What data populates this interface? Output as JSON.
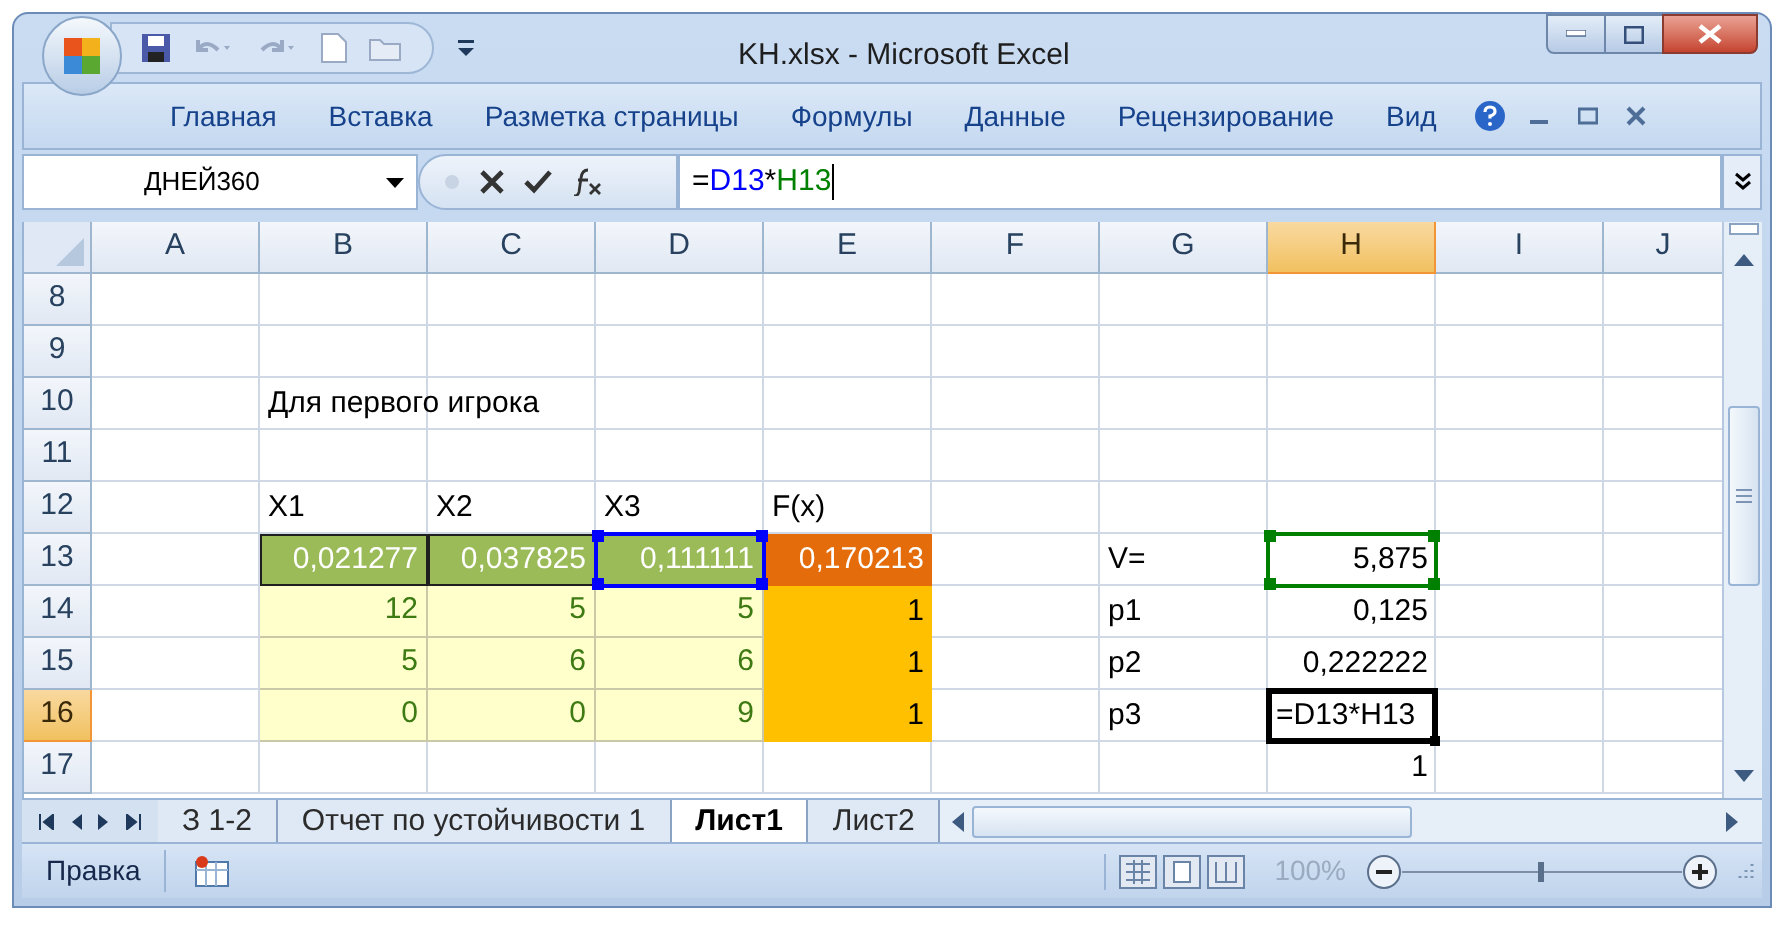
{
  "window": {
    "title": "KH.xlsx - Microsoft Excel"
  },
  "ribbon_tabs": [
    "Главная",
    "Вставка",
    "Разметка страницы",
    "Формулы",
    "Данные",
    "Рецензирование",
    "Вид"
  ],
  "formula_bar": {
    "name_box": "ДНЕЙ360",
    "formula": [
      {
        "text": "=",
        "color": "#000000"
      },
      {
        "text": "D13",
        "color": "#0000ff"
      },
      {
        "text": "*",
        "color": "#000000"
      },
      {
        "text": "H13",
        "color": "#008000"
      }
    ]
  },
  "columns": [
    {
      "label": "A",
      "selected": false
    },
    {
      "label": "B",
      "selected": false
    },
    {
      "label": "C",
      "selected": false
    },
    {
      "label": "D",
      "selected": false
    },
    {
      "label": "E",
      "selected": false
    },
    {
      "label": "F",
      "selected": false
    },
    {
      "label": "G",
      "selected": false
    },
    {
      "label": "H",
      "selected": true
    },
    {
      "label": "I",
      "selected": false
    },
    {
      "label": "J",
      "selected": false
    }
  ],
  "rows": [
    {
      "label": "8",
      "selected": false,
      "cells": [
        null,
        null,
        null,
        null,
        null,
        null,
        null,
        null,
        null,
        null
      ]
    },
    {
      "label": "9",
      "selected": false,
      "cells": [
        null,
        null,
        null,
        null,
        null,
        null,
        null,
        null,
        null,
        null
      ]
    },
    {
      "label": "10",
      "selected": false,
      "cells": [
        null,
        {
          "text": "Для первого игрока",
          "kind": "text"
        },
        null,
        null,
        null,
        null,
        null,
        null,
        null,
        null
      ]
    },
    {
      "label": "11",
      "selected": false,
      "cells": [
        null,
        null,
        null,
        null,
        null,
        null,
        null,
        null,
        null,
        null
      ]
    },
    {
      "label": "12",
      "selected": false,
      "cells": [
        null,
        {
          "text": "X1",
          "kind": "text"
        },
        {
          "text": "X2",
          "kind": "text"
        },
        {
          "text": "X3",
          "kind": "text"
        },
        {
          "text": "F(x)",
          "kind": "text"
        },
        null,
        null,
        null,
        null,
        null
      ]
    },
    {
      "label": "13",
      "selected": false,
      "cells": [
        null,
        {
          "text": "0,021277",
          "kind": "result"
        },
        {
          "text": "0,037825",
          "kind": "result"
        },
        {
          "text": "0,111111",
          "kind": "result",
          "reference": {
            "color": "#0000ff"
          }
        },
        {
          "text": "0,170213",
          "kind": "objective"
        },
        null,
        {
          "text": "V=",
          "kind": "text"
        },
        {
          "text": "5,875",
          "kind": "number",
          "reference": {
            "color": "#008000"
          }
        },
        null,
        null
      ]
    },
    {
      "label": "14",
      "selected": false,
      "cells": [
        null,
        {
          "text": "12",
          "kind": "input"
        },
        {
          "text": "5",
          "kind": "input"
        },
        {
          "text": "5",
          "kind": "input"
        },
        {
          "text": "1",
          "kind": "constraint"
        },
        null,
        {
          "text": "p1",
          "kind": "text"
        },
        {
          "text": "0,125",
          "kind": "number"
        },
        null,
        null
      ]
    },
    {
      "label": "15",
      "selected": false,
      "cells": [
        null,
        {
          "text": "5",
          "kind": "input"
        },
        {
          "text": "6",
          "kind": "input"
        },
        {
          "text": "6",
          "kind": "input"
        },
        {
          "text": "1",
          "kind": "constraint"
        },
        null,
        {
          "text": "p2",
          "kind": "text"
        },
        {
          "text": "0,222222",
          "kind": "number"
        },
        null,
        null
      ]
    },
    {
      "label": "16",
      "selected": true,
      "cells": [
        null,
        {
          "text": "0",
          "kind": "input"
        },
        {
          "text": "0",
          "kind": "input"
        },
        {
          "text": "9",
          "kind": "input"
        },
        {
          "text": "1",
          "kind": "constraint"
        },
        null,
        {
          "text": "p3",
          "kind": "text"
        },
        {
          "text": "=D13*H13",
          "kind": "text",
          "active": true
        },
        null,
        null
      ]
    },
    {
      "label": "17",
      "selected": false,
      "cells": [
        null,
        null,
        null,
        null,
        null,
        null,
        null,
        {
          "text": "1",
          "kind": "number"
        },
        null,
        null
      ]
    }
  ],
  "sheet_tabs": [
    {
      "label": "З 1-2",
      "selected": false
    },
    {
      "label": "Отчет по устойчивости 1",
      "selected": false
    },
    {
      "label": "Лист1",
      "selected": true
    },
    {
      "label": "Лист2",
      "selected": false
    }
  ],
  "status_bar": {
    "mode": "Правка",
    "zoom": "100%",
    "zoom_slider": {
      "level": 0.5
    }
  }
}
